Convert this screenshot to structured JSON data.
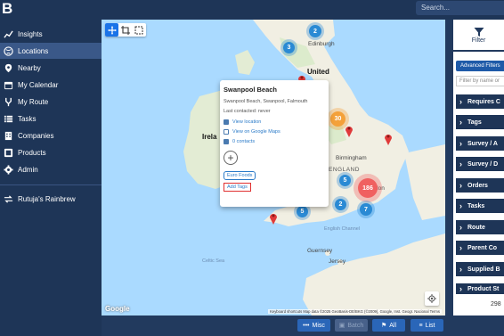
{
  "app": {
    "logo": "B"
  },
  "search": {
    "placeholder": "Search..."
  },
  "sidebar": {
    "items": [
      {
        "label": "Insights",
        "icon": "chart-line-icon"
      },
      {
        "label": "Locations",
        "icon": "globe-icon",
        "active": true
      },
      {
        "label": "Nearby",
        "icon": "pin-icon"
      },
      {
        "label": "My Calendar",
        "icon": "calendar-icon"
      },
      {
        "label": "My Route",
        "icon": "route-icon"
      },
      {
        "label": "Tasks",
        "icon": "tasks-icon"
      },
      {
        "label": "Companies",
        "icon": "building-icon"
      },
      {
        "label": "Products",
        "icon": "products-icon"
      },
      {
        "label": "Admin",
        "icon": "gear-icon"
      }
    ],
    "team": {
      "label": "Rutuja's Rainbrew",
      "icon": "swap-icon"
    }
  },
  "map": {
    "labels": {
      "edinburgh": "Edinburgh",
      "united": "United",
      "ireland": "Irela",
      "birmingham": "Birmingham",
      "england": "ENGLAND",
      "london": "don",
      "english_channel": "English Channel",
      "jersey": "Jersey",
      "guernsey": "Guernsey",
      "celtic_sea": "Celtic Sea",
      "google": "Google",
      "attribution": "Keyboard shortcuts   Map data ©2025 GeoBasis-DE/BKG (©2009), Google, Inst. Geogr. Nacional   Terms"
    },
    "clusters": {
      "c2a": "2",
      "c3": "3",
      "c30": "30",
      "c186": "186",
      "c5a": "5",
      "c2b": "2",
      "c7": "7",
      "c5b": "5"
    },
    "colors": {
      "cluster_blue": "#2a8ad4",
      "cluster_orange": "#f4a13a",
      "cluster_red": "#f06060",
      "pin": "#e03a3a"
    }
  },
  "popup": {
    "title": "Swanpool Beach",
    "address": "Swanpool Beach, Swanpool, Falmouth",
    "last_contacted": "Last contacted: never",
    "view_location": "View location",
    "view_google": "View on Google Maps",
    "contacts": "0 contacts",
    "tag": "Euro Foods",
    "add_tags": "Add Tags"
  },
  "right_panel": {
    "filter_tab": "Filter",
    "advanced_filters": "Advanced Filters",
    "filter_placeholder": "Filter by name or",
    "facets": [
      "Requires C",
      "Tags",
      "Survey / A",
      "Survey / D",
      "Orders",
      "Tasks",
      "Route",
      "Parent Co",
      "Supplied B",
      "Product St"
    ],
    "count": "298"
  },
  "bottom": {
    "misc": "Misc",
    "batch": "Batch",
    "all": "All",
    "list": "List"
  }
}
